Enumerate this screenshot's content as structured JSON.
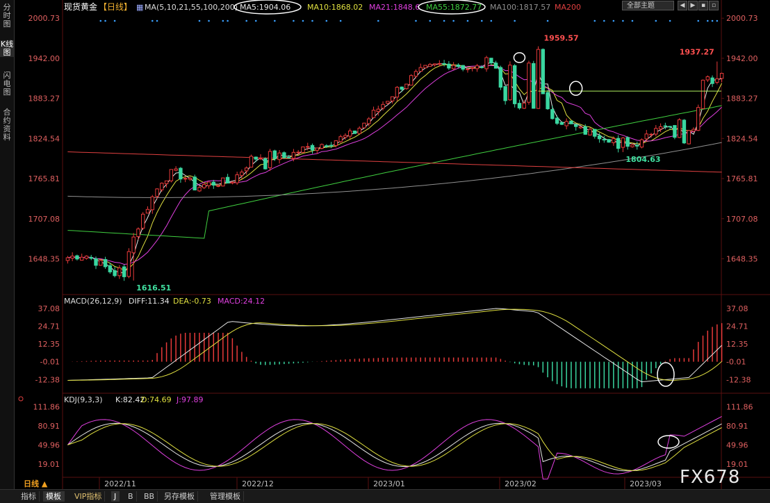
{
  "sidebar": {
    "tabs": [
      {
        "label": "分时图",
        "active": false
      },
      {
        "label": "K线图",
        "active": true
      },
      {
        "label": "闪电图",
        "active": false
      },
      {
        "label": "合约资料",
        "active": false
      }
    ]
  },
  "header": {
    "instrument": "现货黄金",
    "period": "【日线】",
    "scheme": "全部主题",
    "ma_label": "MA(5,10,21,55,100,200)",
    "ma_values": [
      {
        "text": "MA5:1904.06",
        "color": "#e8e8e8"
      },
      {
        "text": "MA10:1868.02",
        "color": "#e0e040"
      },
      {
        "text": "MA21:1848.6",
        "color": "#e040e0"
      },
      {
        "text": "MA55:1872.77",
        "color": "#40d040"
      },
      {
        "text": "MA100:1817.57",
        "color": "#909090"
      },
      {
        "text": "MA200",
        "color": "#e04040"
      }
    ]
  },
  "colors": {
    "up": "#e83a3a",
    "down": "#3ad6a0",
    "axis_text": "#e06060",
    "grid": "#3a1010"
  },
  "watermark": "FX678",
  "bottom_tabs": [
    {
      "label": "日线 ▲",
      "active": false,
      "vip": false,
      "accent": true
    },
    {
      "label": "指标",
      "active": false,
      "vip": false
    },
    {
      "label": "模板",
      "active": true,
      "vip": false
    },
    {
      "label": "VIP指标",
      "active": false,
      "vip": true
    },
    {
      "label": "J",
      "active": true,
      "vip": false
    },
    {
      "label": "B",
      "active": false,
      "vip": false
    },
    {
      "label": "BB",
      "active": false,
      "vip": false
    },
    {
      "label": "另存模板",
      "active": false,
      "vip": false
    },
    {
      "label": "管理模板",
      "active": false,
      "vip": false
    }
  ],
  "chart_data": [
    {
      "type": "candlestick",
      "panel": "price",
      "ylim": [
        1600,
        2005
      ],
      "y_ticks": [
        "2000.73",
        "1942.00",
        "1883.27",
        "1824.54",
        "1765.81",
        "1707.08",
        "1648.35"
      ],
      "x_labels": [
        "2022/11",
        "2022/12",
        "2023/01",
        "2023/02",
        "2023/03"
      ],
      "annotations": [
        {
          "text": "1959.57",
          "value": 1959.57
        },
        {
          "text": "1937.27",
          "value": 1937.27
        },
        {
          "text": "1616.51",
          "value": 1616.51
        },
        {
          "text": "1804.63",
          "value": 1804.63
        }
      ],
      "candles": [],
      "series": [
        {
          "name": "MA5",
          "color": "#e8e8e8"
        },
        {
          "name": "MA10",
          "color": "#e0e040"
        },
        {
          "name": "MA21",
          "color": "#e040e0"
        },
        {
          "name": "MA55",
          "color": "#40d040"
        },
        {
          "name": "MA100",
          "color": "#909090"
        },
        {
          "name": "MA200",
          "color": "#e04040"
        }
      ],
      "horizontal_line": 1894
    },
    {
      "type": "macd",
      "panel": "macd",
      "title": "MACD(26,12,9)",
      "values_text": [
        {
          "text": "DIFF:11.34",
          "color": "#e8e8e8"
        },
        {
          "text": "DEA:-0.73",
          "color": "#e0e040"
        },
        {
          "text": "MACD:24.12",
          "color": "#e040e0"
        }
      ],
      "ylim": [
        -20,
        40
      ],
      "y_ticks": [
        "37.08",
        "24.71",
        "12.35",
        "-0.01",
        "-12.38"
      ]
    },
    {
      "type": "kdj",
      "panel": "kdj",
      "title": "KDJ(9,3,3)",
      "values_text": [
        {
          "text": "K:82.42",
          "color": "#e8e8e8"
        },
        {
          "text": "D:74.69",
          "color": "#e0e040"
        },
        {
          "text": "J:97.89",
          "color": "#e040e0"
        }
      ],
      "ylim": [
        0,
        120
      ],
      "y_ticks": [
        "111.86",
        "80.91",
        "49.96",
        "19.01"
      ]
    }
  ]
}
